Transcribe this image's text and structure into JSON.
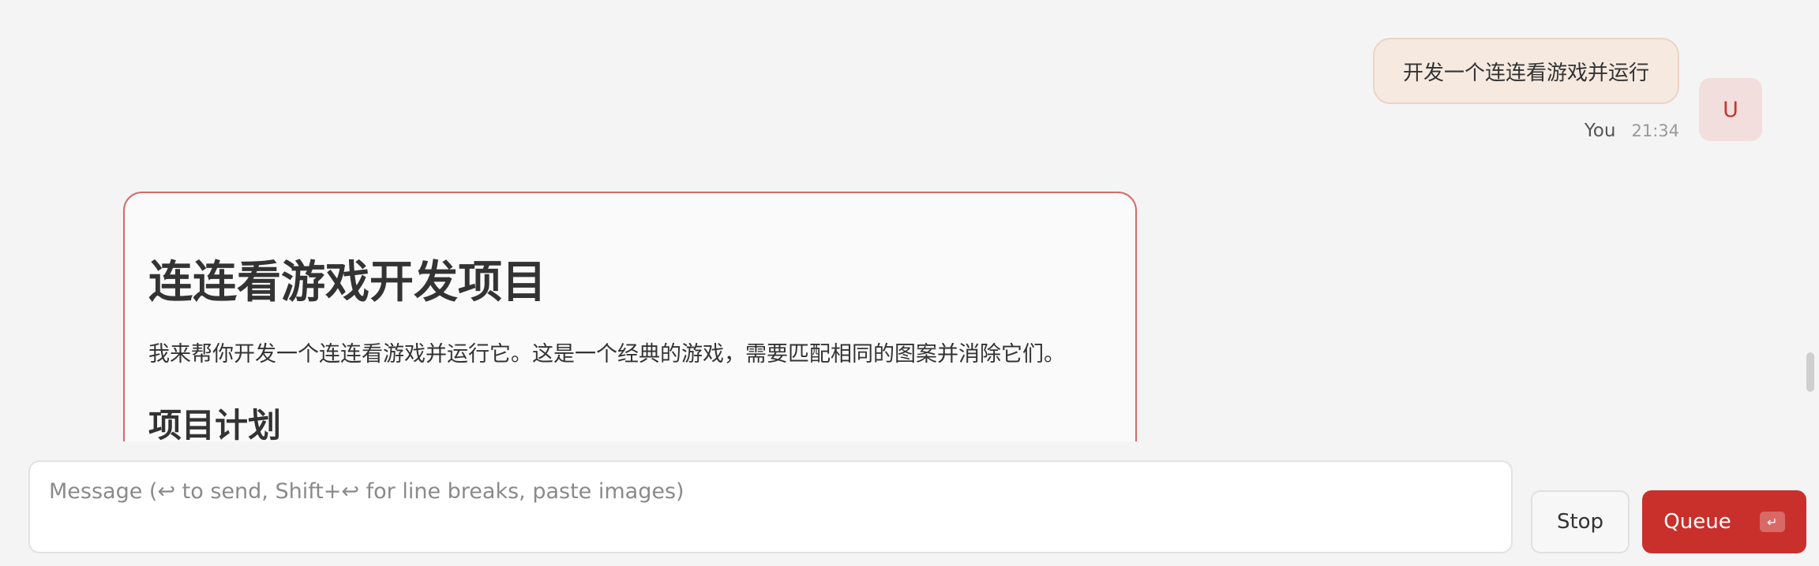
{
  "user_message": {
    "text": "开发一个连连看游戏并运行",
    "sender": "You",
    "time": "21:34",
    "avatar_letter": "U"
  },
  "assistant_message": {
    "title": "连连看游戏开发项目",
    "paragraph": "我来帮你开发一个连连看游戏并运行它。这是一个经典的游戏，需要匹配相同的图案并消除它们。",
    "section_heading": "项目计划"
  },
  "composer": {
    "placeholder": "Message (↩ to send, Shift+↩ for line breaks, paste images)",
    "stop_label": "Stop",
    "queue_label": "Queue",
    "enter_glyph": "↵"
  },
  "colors": {
    "accent": "#c9302c",
    "user_bubble": "#f6e9e0",
    "card_border": "#d46a66"
  },
  "icons": {
    "enter_key": "enter-key-icon"
  }
}
